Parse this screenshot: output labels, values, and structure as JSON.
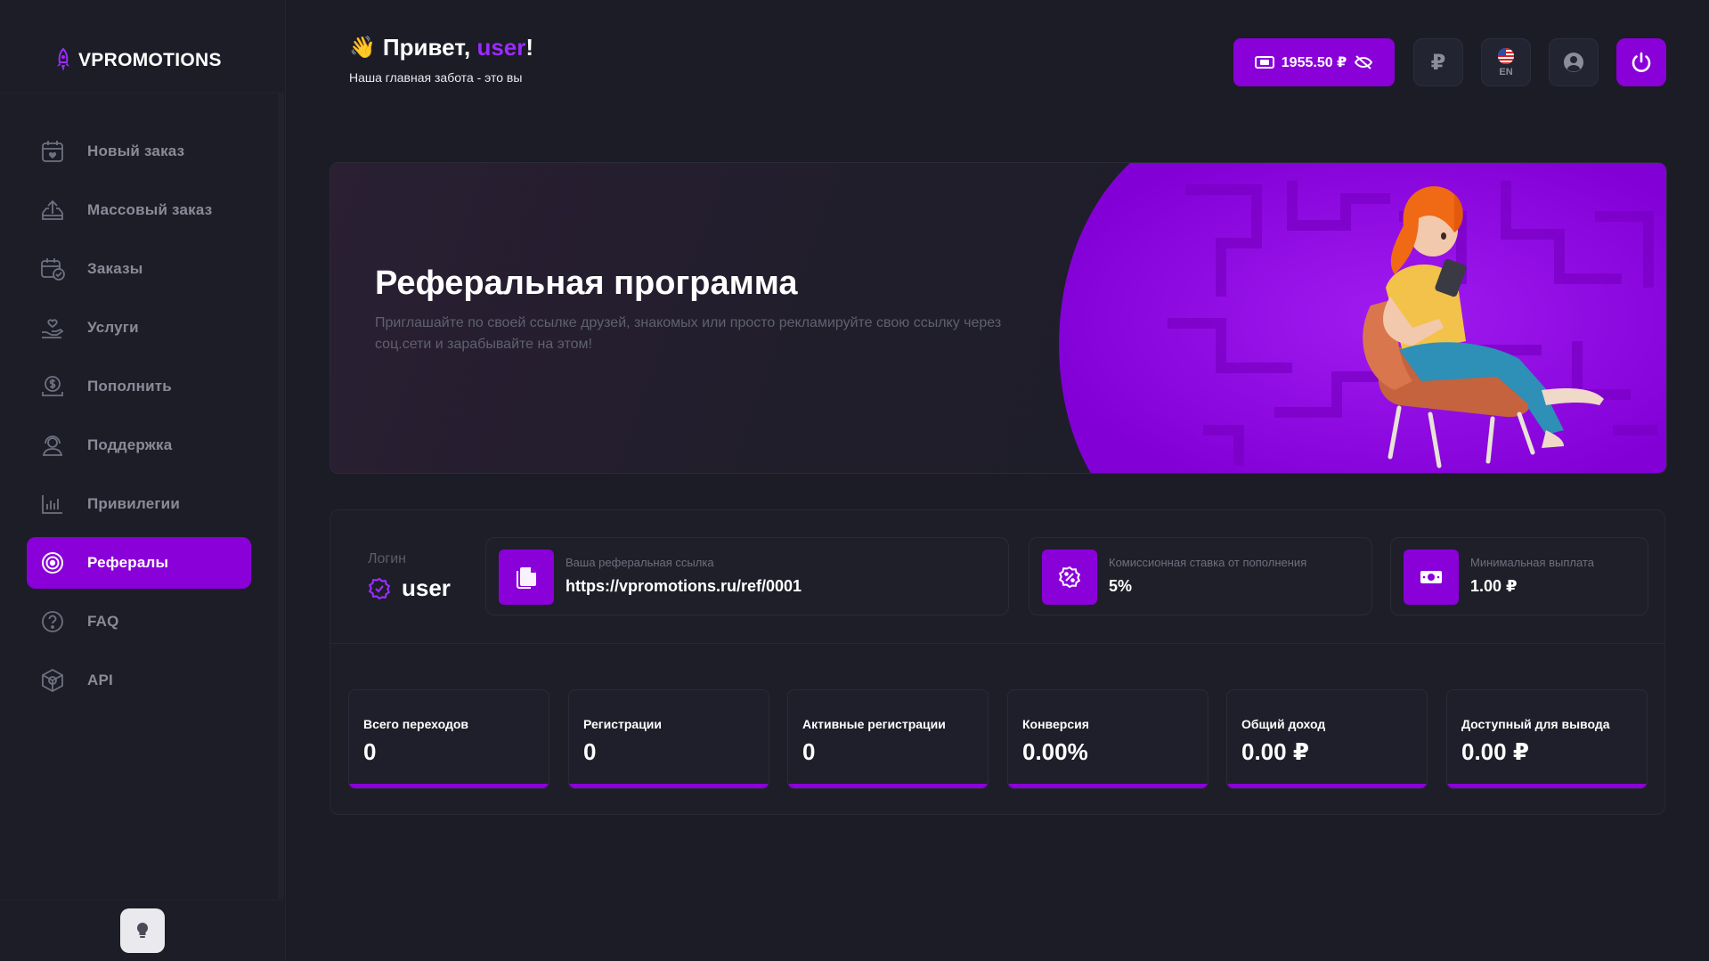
{
  "brand": {
    "name": "VPROMOTIONS"
  },
  "sidebar": {
    "items": [
      {
        "label": "Новый заказ",
        "icon": "calendar-heart-icon",
        "active": false
      },
      {
        "label": "Массовый заказ",
        "icon": "upload-tray-icon",
        "active": false
      },
      {
        "label": "Заказы",
        "icon": "calendar-check-icon",
        "active": false
      },
      {
        "label": "Услуги",
        "icon": "hand-heart-icon",
        "active": false
      },
      {
        "label": "Пополнить",
        "icon": "dollar-coin-icon",
        "active": false
      },
      {
        "label": "Поддержка",
        "icon": "support-agent-icon",
        "active": false
      },
      {
        "label": "Привилегии",
        "icon": "bar-chart-icon",
        "active": false
      },
      {
        "label": "Рефералы",
        "icon": "target-icon",
        "active": true
      },
      {
        "label": "FAQ",
        "icon": "question-circle-icon",
        "active": false
      },
      {
        "label": "API",
        "icon": "cube-icon",
        "active": false
      }
    ]
  },
  "header": {
    "greeting_prefix": "Привет,",
    "greeting_user": "user",
    "greeting_suffix": "!",
    "subtitle": "Наша главная забота - это вы",
    "balance": "1955.50 ₽",
    "currency_symbol": "₽",
    "language": "EN"
  },
  "hero": {
    "title": "Реферальная программа",
    "description": "Приглашайте по своей ссылке друзей, знакомых или просто рекламируйте свою ссылку через соц.сети и зарабывайте на этом!"
  },
  "info": {
    "login_label": "Логин",
    "login_value": "user",
    "cards": [
      {
        "label": "Ваша реферальная ссылка",
        "value": "https://vpromotions.ru/ref/0001",
        "icon": "copy-icon"
      },
      {
        "label": "Комиссионная ставка от пополнения",
        "value": "5%",
        "icon": "percent-badge-icon"
      },
      {
        "label": "Минимальная выплата",
        "value": "1.00 ₽",
        "icon": "banknote-icon"
      }
    ],
    "stats": [
      {
        "label": "Всего переходов",
        "value": "0"
      },
      {
        "label": "Регистрации",
        "value": "0"
      },
      {
        "label": "Активные регистрации",
        "value": "0"
      },
      {
        "label": "Конверсия",
        "value": "0.00%"
      },
      {
        "label": "Общий доход",
        "value": "0.00 ₽"
      },
      {
        "label": "Доступный для вывода",
        "value": "0.00 ₽"
      }
    ]
  },
  "colors": {
    "accent": "#8a00d9",
    "accent_text": "#9b2bff",
    "background": "#1b1c26",
    "muted": "#8a8b98"
  }
}
